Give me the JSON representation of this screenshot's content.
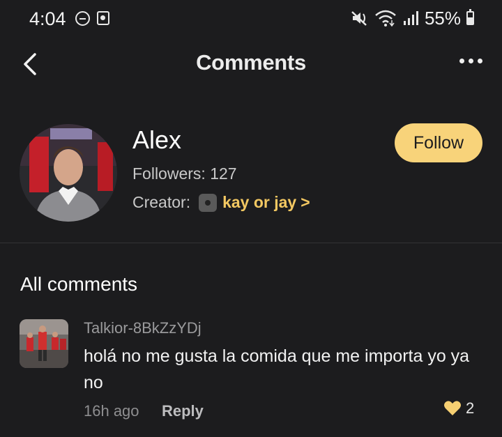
{
  "status_bar": {
    "time": "4:04",
    "battery": "55%",
    "icons": [
      "do-not-disturb-icon",
      "app-notification-icon",
      "mute-icon",
      "wifi-icon",
      "signal-icon",
      "battery-icon"
    ]
  },
  "header": {
    "title": "Comments",
    "back_icon": "chevron-left-icon",
    "more_icon": "more-horizontal-icon"
  },
  "profile": {
    "name": "Alex",
    "followers_label": "Followers: 127",
    "creator_label": "Creator:",
    "creator_name": "kay or jay",
    "creator_chevron": ">",
    "follow_label": "Follow"
  },
  "comments_section": {
    "title": "All comments",
    "items": [
      {
        "author": "Talkior-8BkZzYDj",
        "text": "holá no me gusta la comida que me importa yo ya no",
        "time": "16h ago",
        "reply_label": "Reply",
        "likes": "2"
      }
    ]
  },
  "colors": {
    "background": "#1c1c1e",
    "accent": "#f8d37a",
    "creator_link": "#f3c862",
    "like_heart": "#f6cf72"
  }
}
